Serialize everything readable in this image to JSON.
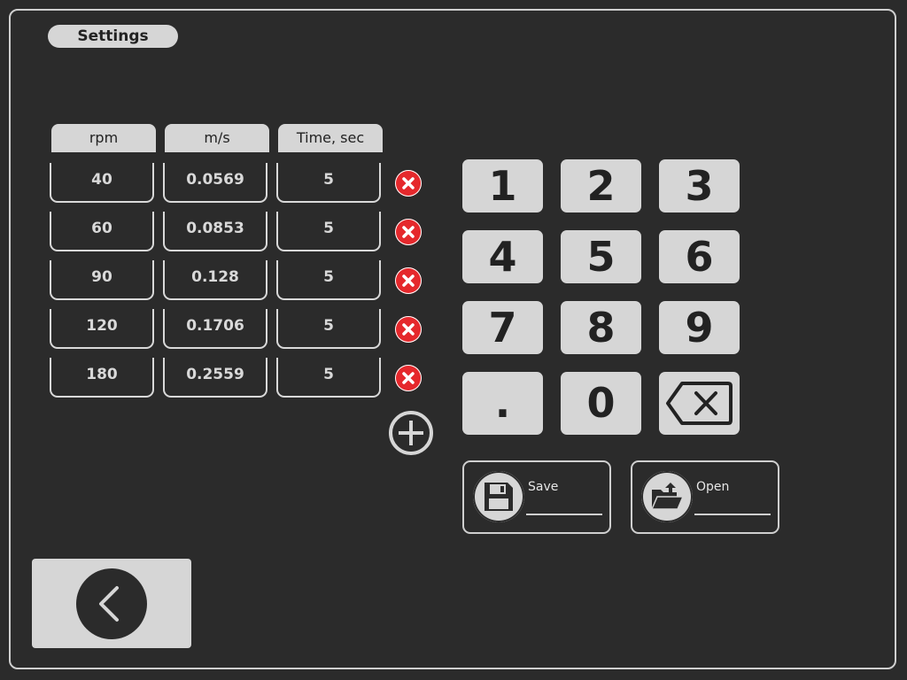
{
  "header": {
    "title": "Settings"
  },
  "table": {
    "columns": [
      "rpm",
      "m/s",
      "Time, sec"
    ],
    "rows": [
      [
        "40",
        "0.0569",
        "5"
      ],
      [
        "60",
        "0.0853",
        "5"
      ],
      [
        "90",
        "0.128",
        "5"
      ],
      [
        "120",
        "0.1706",
        "5"
      ],
      [
        "180",
        "0.2559",
        "5"
      ]
    ]
  },
  "keypad": {
    "keys": [
      "1",
      "2",
      "3",
      "4",
      "5",
      "6",
      "7",
      "8",
      "9",
      ".",
      "0"
    ],
    "backspace_icon": "backspace-icon"
  },
  "actions": {
    "save_label": "Save",
    "open_label": "Open",
    "save_icon": "floppy-disk-icon",
    "open_icon": "folder-open-icon"
  },
  "icons": {
    "delete_row": "delete-x-icon",
    "add_row": "plus-circle-icon",
    "back": "chevron-left-icon"
  },
  "colors": {
    "background": "#2b2b2b",
    "panel": "#d6d6d6",
    "delete": "#e5282c"
  }
}
